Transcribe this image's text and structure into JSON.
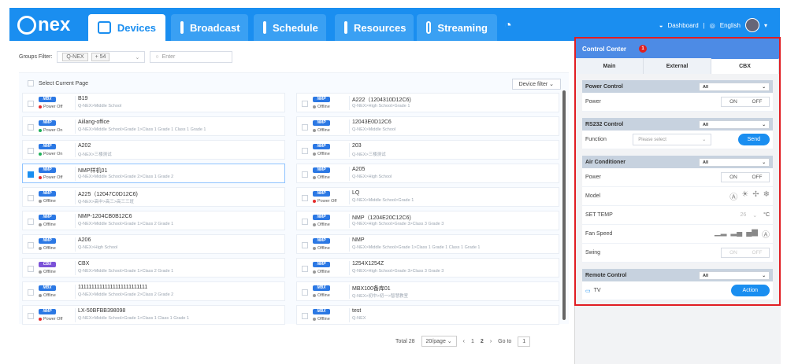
{
  "app": {
    "brand": "nex"
  },
  "tabs": [
    {
      "label": "Devices"
    },
    {
      "label": "Broadcast"
    },
    {
      "label": "Schedule"
    },
    {
      "label": "Resources"
    },
    {
      "label": "Streaming"
    }
  ],
  "top": {
    "dashboard": "Dashboard",
    "language": "English"
  },
  "filter": {
    "label": "Groups Filter:",
    "tag1": "Q-NEX",
    "tag2": "+ 54",
    "search_placeholder": "Enter"
  },
  "select_current_page": "Select Current Page",
  "device_filter": "Device filter",
  "devices": [
    {
      "type": "MBX",
      "status": "Power Off",
      "name": "B19",
      "path": "Q-NEX>Middle School"
    },
    {
      "type": "NMP",
      "status": "Offline",
      "name": "A222（1204310D12C6)",
      "path": "Q-NEX>High School>Grade 1"
    },
    {
      "type": "NMP",
      "status": "Power On",
      "name": "Aiilang-office",
      "path": "Q-NEX>Middle School>Grade 1>Class 1 Grade 1 Class 1 Grade 1"
    },
    {
      "type": "NMP",
      "status": "Offline",
      "name": "12043E0D12C6",
      "path": "Q-NEX>Middle School"
    },
    {
      "type": "NMP",
      "status": "Power On",
      "name": "A202",
      "path": "Q-NEX>三楼测试"
    },
    {
      "type": "NMP",
      "status": "Offline",
      "name": "203",
      "path": "Q-NEX>三楼测试"
    },
    {
      "type": "NMP",
      "status": "Power Off",
      "name": "NMP样机01",
      "path": "Q-NEX>Middle School>Grade 2>Class 1 Grade 2"
    },
    {
      "type": "NMP",
      "status": "Offline",
      "name": "A205",
      "path": "Q-NEX>High School"
    },
    {
      "type": "NMP",
      "status": "Offline",
      "name": "A225（12047C0D12C6)",
      "path": "Q-NEX>高中>高三>高三三班"
    },
    {
      "type": "NMP",
      "status": "Power Off",
      "name": "LQ",
      "path": "Q-NEX>Middle School>Grade 1"
    },
    {
      "type": "NMP",
      "status": "Offline",
      "name": "NMP-1204CB0B12C6",
      "path": "Q-NEX>Middle School>Grade 1>Class 2 Grade 1"
    },
    {
      "type": "NMP",
      "status": "Offline",
      "name": "NMP（1204E20C12C6)",
      "path": "Q-NEX>High School>Grade 3>Class 3 Grade 3"
    },
    {
      "type": "NMP",
      "status": "Offline",
      "name": "A206",
      "path": "Q-NEX>High School"
    },
    {
      "type": "NMP",
      "status": "Offline",
      "name": "NMP",
      "path": "Q-NEX>Middle School>Grade 1>Class 1 Grade 1 Class 1 Grade 1"
    },
    {
      "type": "CBX",
      "status": "Offline",
      "name": "CBX",
      "path": "Q-NEX>Middle School>Grade 1>Class 2 Grade 1"
    },
    {
      "type": "NMP",
      "status": "Offline",
      "name": "1254X1254Z",
      "path": "Q-NEX>High School>Grade 3>Class 3 Grade 3"
    },
    {
      "type": "MBX",
      "status": "Offline",
      "name": "11111111111111111111111111",
      "path": "Q-NEX>Middle School>Grade 2>Class 2 Grade 2"
    },
    {
      "type": "MBX",
      "status": "Offline",
      "name": "MBX100备库01",
      "path": "Q-NEX>初中>初一>智慧教室"
    },
    {
      "type": "NMP",
      "status": "Power Off",
      "name": "LX-50BFBB398098",
      "path": "Q-NEX>Middle School>Grade 1>Class 1 Class 1 Grade 1"
    },
    {
      "type": "MBX",
      "status": "Offline",
      "name": "test",
      "path": "Q-NEX"
    }
  ],
  "pagination": {
    "total": "Total 28",
    "per_page": "20/page",
    "page1": "1",
    "page2": "2",
    "goto": "Go to",
    "goto_value": "1"
  },
  "control": {
    "title": "Control Center",
    "count": "1",
    "tabs": [
      "Main",
      "External",
      "CBX"
    ],
    "power_control": {
      "title": "Power Control",
      "select": "All",
      "label": "Power",
      "on": "ON",
      "off": "OFF"
    },
    "rs232": {
      "title": "RS232 Control",
      "select": "All",
      "label": "Function",
      "placeholder": "Please select",
      "button": "Send"
    },
    "air": {
      "title": "Air Conditioner",
      "select": "All",
      "power": "Power",
      "on": "ON",
      "off": "OFF",
      "model": "Model",
      "set_temp": "SET TEMP",
      "temp": "26",
      "unit": "°C",
      "fan": "Fan Speed",
      "swing": "Swing",
      "swing_on": "ON",
      "swing_off": "OFF"
    },
    "remote": {
      "title": "Remote Control",
      "select": "All",
      "tv": "TV",
      "button": "Action"
    }
  }
}
